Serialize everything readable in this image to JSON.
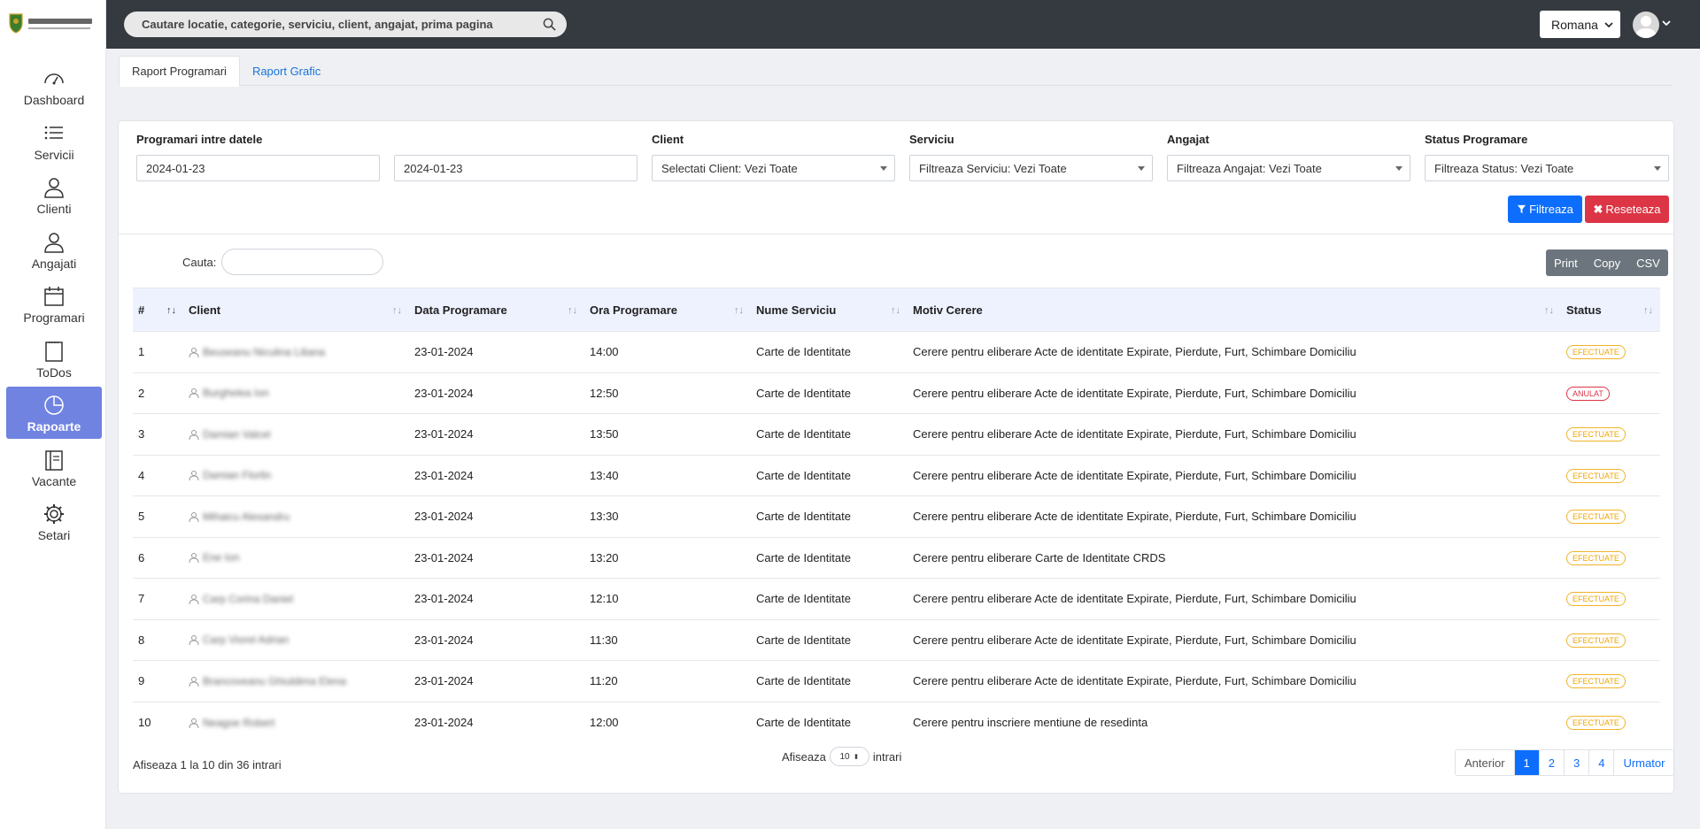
{
  "brand": {
    "logo_text": "MENERE"
  },
  "sidebar": {
    "items": [
      {
        "label": "Dashboard",
        "icon": "dashboard-icon"
      },
      {
        "label": "Servicii",
        "icon": "list-icon"
      },
      {
        "label": "Clienti",
        "icon": "user-icon"
      },
      {
        "label": "Angajati",
        "icon": "user-icon"
      },
      {
        "label": "Programari",
        "icon": "calendar-icon"
      },
      {
        "label": "ToDos",
        "icon": "notepad-icon"
      },
      {
        "label": "Rapoarte",
        "icon": "pie-chart-icon",
        "active": true
      },
      {
        "label": "Vacante",
        "icon": "book-icon"
      },
      {
        "label": "Setari",
        "icon": "gear-icon"
      }
    ]
  },
  "topbar": {
    "search_placeholder": "Cautare locatie, categorie, serviciu, client, angajat, prima pagina",
    "language": "Romana"
  },
  "tabs": [
    {
      "label": "Raport Programari",
      "active": true
    },
    {
      "label": "Raport Grafic",
      "active": false
    }
  ],
  "filters": {
    "date_label": "Programari intre datele",
    "date_from": "2024-01-23",
    "date_to": "2024-01-23",
    "client_label": "Client",
    "client_value": "Selectati Client: Vezi Toate",
    "serviciu_label": "Serviciu",
    "serviciu_value": "Filtreaza Serviciu: Vezi Toate",
    "angajat_label": "Angajat",
    "angajat_value": "Filtreaza Angajat: Vezi Toate",
    "status_label": "Status Programare",
    "status_value": "Filtreaza Status: Vezi Toate",
    "filter_button": "Filtreaza",
    "reset_button": "Reseteaza"
  },
  "table_tools": {
    "search_label": "Cauta:",
    "export_buttons": [
      "Print",
      "Copy",
      "CSV"
    ]
  },
  "table": {
    "columns": [
      "#",
      "Client",
      "Data Programare",
      "Ora Programare",
      "Nume Serviciu",
      "Motiv Cerere",
      "Status"
    ],
    "rows": [
      {
        "num": "1",
        "client": "Beuseanu Niculina Liliana",
        "date": "23-01-2024",
        "time": "14:00",
        "service": "Carte de Identitate",
        "reason": "Cerere pentru eliberare Acte de identitate Expirate, Pierdute, Furt, Schimbare Domiciliu",
        "status": "EFECTUATE"
      },
      {
        "num": "2",
        "client": "Burghelea Ion",
        "date": "23-01-2024",
        "time": "12:50",
        "service": "Carte de Identitate",
        "reason": "Cerere pentru eliberare Acte de identitate Expirate, Pierdute, Furt, Schimbare Domiciliu",
        "status": "ANULAT"
      },
      {
        "num": "3",
        "client": "Damian Valcel",
        "date": "23-01-2024",
        "time": "13:50",
        "service": "Carte de Identitate",
        "reason": "Cerere pentru eliberare Acte de identitate Expirate, Pierdute, Furt, Schimbare Domiciliu",
        "status": "EFECTUATE"
      },
      {
        "num": "4",
        "client": "Damian Florlin",
        "date": "23-01-2024",
        "time": "13:40",
        "service": "Carte de Identitate",
        "reason": "Cerere pentru eliberare Acte de identitate Expirate, Pierdute, Furt, Schimbare Domiciliu",
        "status": "EFECTUATE"
      },
      {
        "num": "5",
        "client": "Mihaicu Alexandru",
        "date": "23-01-2024",
        "time": "13:30",
        "service": "Carte de Identitate",
        "reason": "Cerere pentru eliberare Acte de identitate Expirate, Pierdute, Furt, Schimbare Domiciliu",
        "status": "EFECTUATE"
      },
      {
        "num": "6",
        "client": "Ene Ion",
        "date": "23-01-2024",
        "time": "13:20",
        "service": "Carte de Identitate",
        "reason": "Cerere pentru eliberare Carte de Identitate CRDS",
        "status": "EFECTUATE"
      },
      {
        "num": "7",
        "client": "Carp Corina Daniel",
        "date": "23-01-2024",
        "time": "12:10",
        "service": "Carte de Identitate",
        "reason": "Cerere pentru eliberare Acte de identitate Expirate, Pierdute, Furt, Schimbare Domiciliu",
        "status": "EFECTUATE"
      },
      {
        "num": "8",
        "client": "Carp Viorel Adrian",
        "date": "23-01-2024",
        "time": "11:30",
        "service": "Carte de Identitate",
        "reason": "Cerere pentru eliberare Acte de identitate Expirate, Pierdute, Furt, Schimbare Domiciliu",
        "status": "EFECTUATE"
      },
      {
        "num": "9",
        "client": "Brancoveanu Ghiuldima Elena",
        "date": "23-01-2024",
        "time": "11:20",
        "service": "Carte de Identitate",
        "reason": "Cerere pentru eliberare Acte de identitate Expirate, Pierdute, Furt, Schimbare Domiciliu",
        "status": "EFECTUATE"
      },
      {
        "num": "10",
        "client": "Neagoe Robert",
        "date": "23-01-2024",
        "time": "12:00",
        "service": "Carte de Identitate",
        "reason": "Cerere pentru inscriere mentiune de resedinta",
        "status": "EFECTUATE"
      }
    ]
  },
  "footer": {
    "info": "Afiseaza 1 la 10 din 36 intrari",
    "page_size_prefix": "Afiseaza",
    "page_size": "10",
    "page_size_suffix": "intrari",
    "pagination": [
      "Anterior",
      "1",
      "2",
      "3",
      "4",
      "Urmator"
    ],
    "current_page": "1"
  },
  "colors": {
    "topbar": "#343a40",
    "sidebar_active": "#7083e1",
    "primary": "#0d6efd",
    "danger": "#dc3545",
    "status_done": "#f0a500",
    "table_header": "#eef2ff"
  }
}
